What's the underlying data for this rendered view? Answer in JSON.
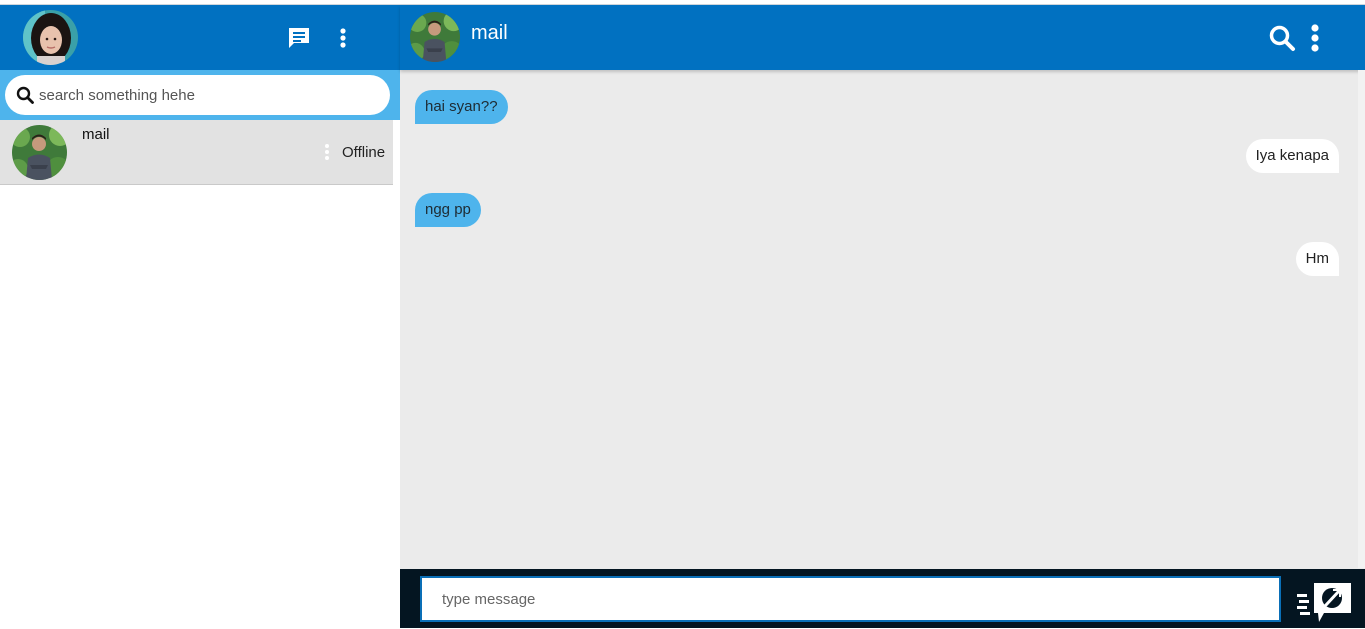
{
  "sidebar": {
    "user_avatar": "user-avatar",
    "icons": {
      "new_chat": "chat-icon",
      "menu": "more-vertical-icon",
      "search": "search-icon"
    },
    "search": {
      "placeholder": "search something hehe",
      "value": ""
    },
    "contacts": [
      {
        "name": "mail",
        "status": "Offline",
        "selected": true
      }
    ]
  },
  "chat": {
    "peer_name": "mail",
    "icons": {
      "search": "search-icon",
      "menu": "more-vertical-icon",
      "send": "send-icon"
    },
    "messages": [
      {
        "text": "hai syan??",
        "direction": "incoming"
      },
      {
        "text": "Iya kenapa",
        "direction": "outgoing"
      },
      {
        "text": "ngg pp",
        "direction": "incoming"
      },
      {
        "text": "Hm",
        "direction": "outgoing"
      }
    ],
    "composer": {
      "placeholder": "type message",
      "value": ""
    }
  },
  "colors": {
    "header": "#0171c1",
    "accent_light": "#4eb4ec",
    "chat_background": "#ebebeb",
    "contact_selected": "#e2e2e2",
    "composer_bar": "#041521"
  }
}
